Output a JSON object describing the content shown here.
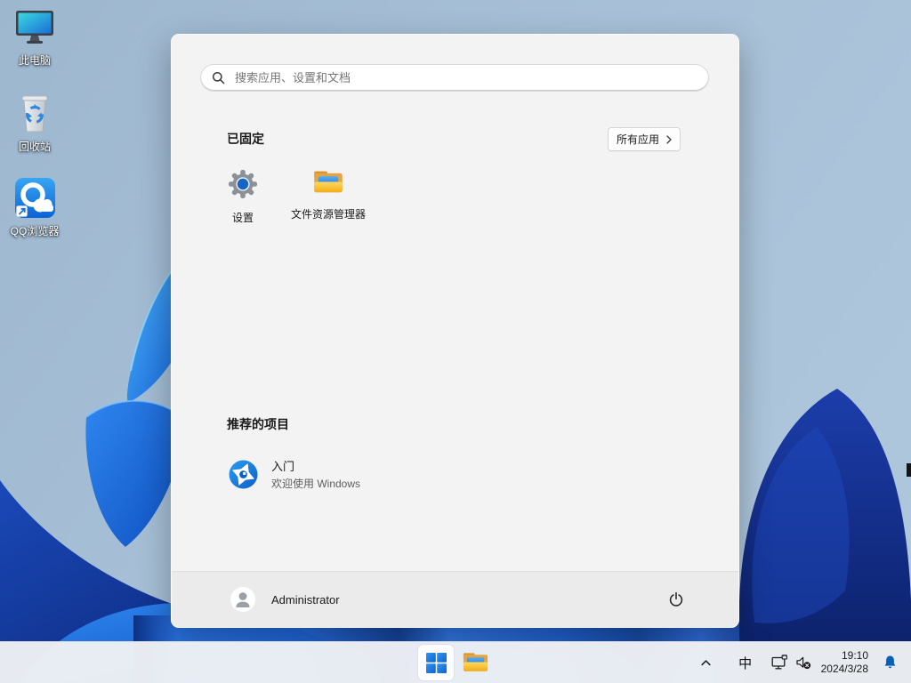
{
  "desktop": {
    "icons": [
      {
        "label": "此电脑"
      },
      {
        "label": "回收站"
      },
      {
        "label": "QQ浏览器"
      }
    ]
  },
  "start_menu": {
    "search_placeholder": "搜索应用、设置和文档",
    "pinned_title": "已固定",
    "all_apps_label": "所有应用",
    "pinned_apps": [
      {
        "label": "设置"
      },
      {
        "label": "文件资源管理器"
      }
    ],
    "recommended_title": "推荐的项目",
    "recommended": [
      {
        "title": "入门",
        "subtitle": "欢迎使用 Windows"
      }
    ],
    "user_name": "Administrator"
  },
  "taskbar": {
    "input_method_label": "中",
    "clock": {
      "time": "19:10",
      "date": "2024/3/28"
    }
  },
  "colors": {
    "accent_blue": "#1b78dd",
    "bell_blue": "#0a5fb4",
    "menu_bg": "#f3f3f3",
    "taskbar_bg": "#eef1f4",
    "wallpaper_bright_blue": "#2a74e6",
    "wallpaper_dark_blue": "#0a2270"
  }
}
